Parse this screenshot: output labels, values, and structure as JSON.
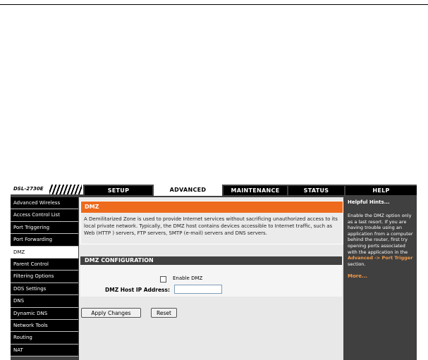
{
  "logo": {
    "model": "DSL-2730E"
  },
  "tabs": [
    "SETUP",
    "ADVANCED",
    "MAINTENANCE",
    "STATUS",
    "HELP"
  ],
  "active_tab": "ADVANCED",
  "sidebar": {
    "items": [
      "Advanced Wireless",
      "Access Control List",
      "Port Triggering",
      "Port Forwarding",
      "DMZ",
      "Parent Control",
      "Filtering Options",
      "DOS Settings",
      "DNS",
      "Dynamic DNS",
      "Network Tools",
      "Routing",
      "NAT"
    ],
    "active": "DMZ"
  },
  "dmz": {
    "title": "DMZ",
    "description": "A Demilitarized Zone is used to provide Internet services without sacrificing unauthorized access to its local private network. Typically, the DMZ host contains devices accessible to Internet traffic, such as Web (HTTP ) servers, FTP servers, SMTP (e-mail) servers and DNS servers."
  },
  "config": {
    "title": "DMZ CONFIGURATION",
    "enable_label": "Enable DMZ",
    "ip_label": "DMZ Host IP Address:",
    "ip_value": ""
  },
  "buttons": {
    "apply": "Apply Changes",
    "reset": "Reset"
  },
  "hints": {
    "title": "Helpful Hints...",
    "text": "Enable the DMZ option only as a last resort. If you are having trouble using an application from a computer behind the router, first try opening ports associated with the application in the",
    "link": "Advanced -> Port Trigger",
    "suffix": " section.",
    "more": "More..."
  },
  "colors": {
    "accent": "#ee6a1d",
    "dark": "#404040",
    "link": "#f29b4a"
  }
}
